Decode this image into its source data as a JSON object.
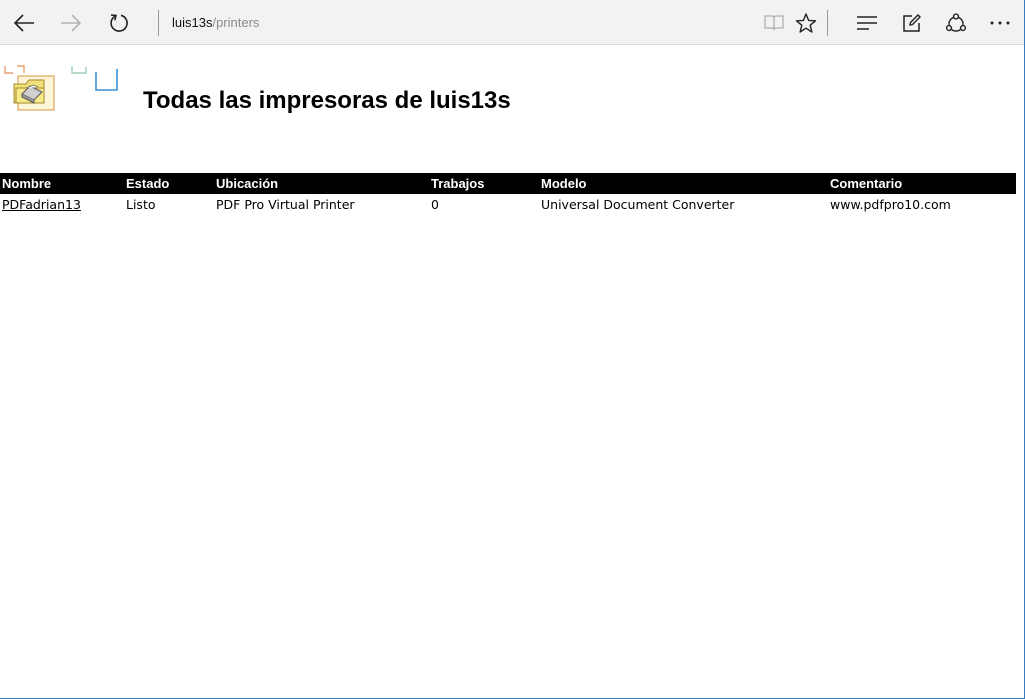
{
  "browser": {
    "address": {
      "host": "luis13s",
      "path": "/printers"
    }
  },
  "page": {
    "title": "Todas las impresoras de luis13s"
  },
  "table": {
    "columns": [
      "Nombre",
      "Estado",
      "Ubicación",
      "Trabajos",
      "Modelo",
      "Comentario"
    ],
    "rows": [
      {
        "name": "PDFadrian13",
        "status": "Listo",
        "location": "PDF Pro Virtual Printer",
        "jobs": "0",
        "model": "Universal Document Converter",
        "comment": "www.pdfpro10.com"
      }
    ]
  },
  "colors": {
    "header_bg": "#000000",
    "header_text": "#ffffff",
    "status_ready": "#008000",
    "toolbar_bg": "#f2f2f2"
  },
  "icons": [
    "back-arrow-icon",
    "forward-arrow-icon",
    "refresh-icon",
    "reading-view-icon",
    "favorite-star-icon",
    "hub-icon",
    "web-note-icon",
    "share-icon",
    "more-icon",
    "printer-folder-icon"
  ]
}
